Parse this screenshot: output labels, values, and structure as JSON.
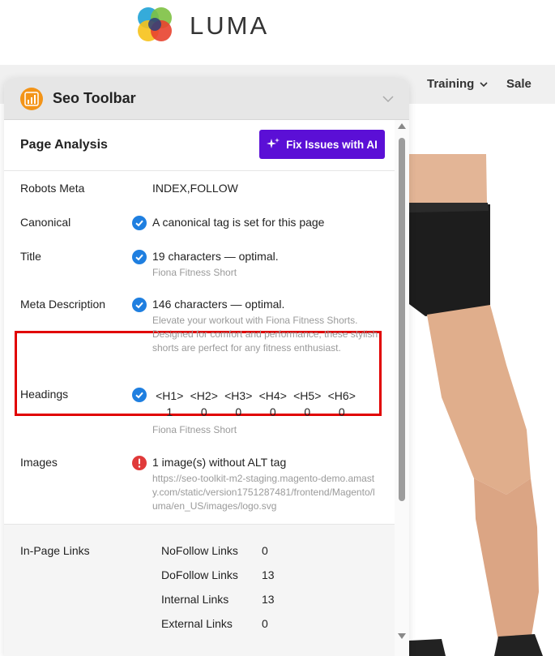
{
  "store": {
    "logo_text": "LUMA",
    "nav": {
      "training": "Training",
      "sale": "Sale"
    }
  },
  "toolbar": {
    "title": "Seo Toolbar",
    "section_title": "Page Analysis",
    "ai_button": "Fix Issues with AI",
    "rows": {
      "robots": {
        "label": "Robots Meta",
        "value": "INDEX,FOLLOW"
      },
      "canonical": {
        "label": "Canonical",
        "value": "A canonical tag is set for this page",
        "status": "ok"
      },
      "title": {
        "label": "Title",
        "value": "19 characters — optimal.",
        "sub": "Fiona Fitness Short",
        "status": "ok"
      },
      "meta_description": {
        "label": "Meta Description",
        "value": "146 characters — optimal.",
        "sub": "Elevate your workout with Fiona Fitness Shorts. Designed for comfort and performance, these stylish shorts are perfect for any fitness enthusiast.",
        "status": "ok"
      },
      "headings": {
        "label": "Headings",
        "status": "ok",
        "columns": [
          {
            "tag": "<H1>",
            "count": "1"
          },
          {
            "tag": "<H2>",
            "count": "0"
          },
          {
            "tag": "<H3>",
            "count": "0"
          },
          {
            "tag": "<H4>",
            "count": "0"
          },
          {
            "tag": "<H5>",
            "count": "0"
          },
          {
            "tag": "<H6>",
            "count": "0"
          }
        ],
        "sub": "Fiona Fitness Short"
      },
      "images": {
        "label": "Images",
        "value": "1 image(s) without ALT tag",
        "sub": "https://seo-toolkit-m2-staging.magento-demo.amasty.com/static/version1751287481/frontend/Magento/luma/en_US/images/logo.svg",
        "status": "error"
      }
    },
    "links": {
      "label": "In-Page Links",
      "items": [
        {
          "name": "NoFollow Links",
          "count": "0"
        },
        {
          "name": "DoFollow Links",
          "count": "13"
        },
        {
          "name": "Internal Links",
          "count": "13"
        },
        {
          "name": "External Links",
          "count": "0"
        }
      ]
    }
  },
  "colors": {
    "accent_purple": "#5b0fd6",
    "ok_blue": "#1f7fe0",
    "error_red": "#e03a3a",
    "highlight_red": "#e10000",
    "logo_orange": "#f39418"
  }
}
